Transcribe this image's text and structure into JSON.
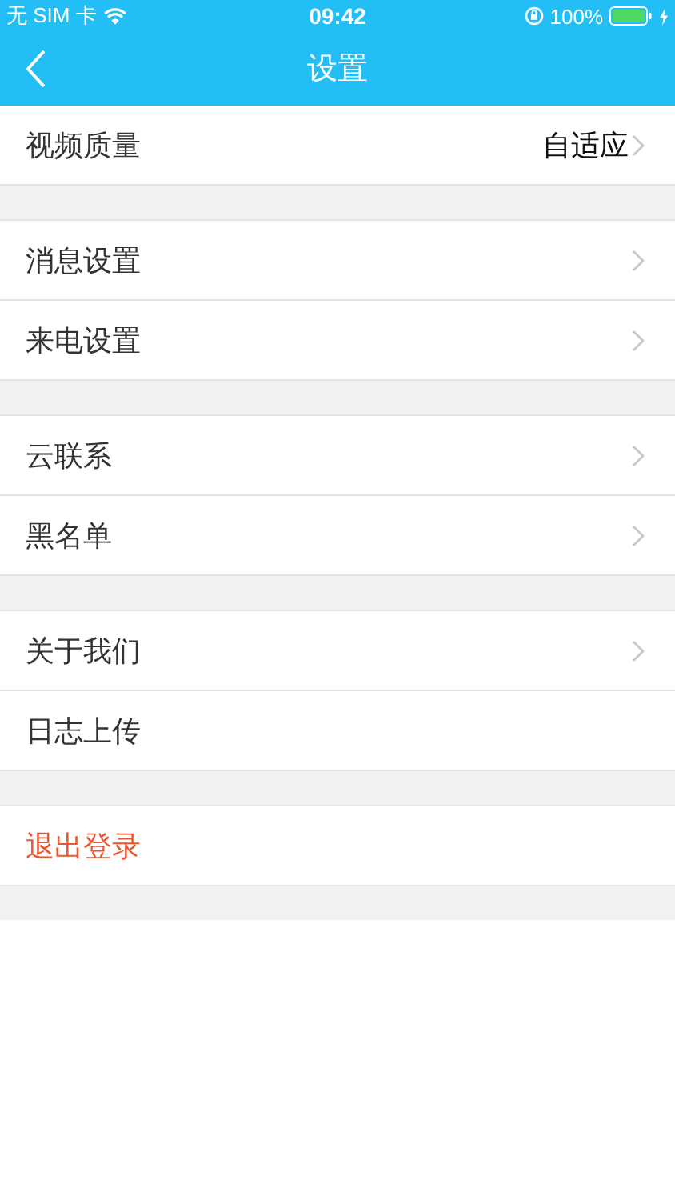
{
  "status_bar": {
    "carrier": "无 SIM 卡",
    "time": "09:42",
    "battery": "100%"
  },
  "nav": {
    "title": "设置"
  },
  "groups": [
    {
      "items": [
        {
          "label": "视频质量",
          "value": "自适应",
          "chevron": true,
          "kind": "normal"
        }
      ]
    },
    {
      "items": [
        {
          "label": "消息设置",
          "chevron": true,
          "kind": "normal"
        },
        {
          "label": "来电设置",
          "chevron": true,
          "kind": "normal"
        }
      ]
    },
    {
      "items": [
        {
          "label": "云联系",
          "chevron": true,
          "kind": "normal"
        },
        {
          "label": "黑名单",
          "chevron": true,
          "kind": "normal"
        }
      ]
    },
    {
      "items": [
        {
          "label": "关于我们",
          "chevron": true,
          "kind": "normal"
        },
        {
          "label": "日志上传",
          "chevron": false,
          "kind": "normal"
        }
      ]
    },
    {
      "items": [
        {
          "label": "退出登录",
          "chevron": false,
          "kind": "danger"
        }
      ]
    }
  ]
}
